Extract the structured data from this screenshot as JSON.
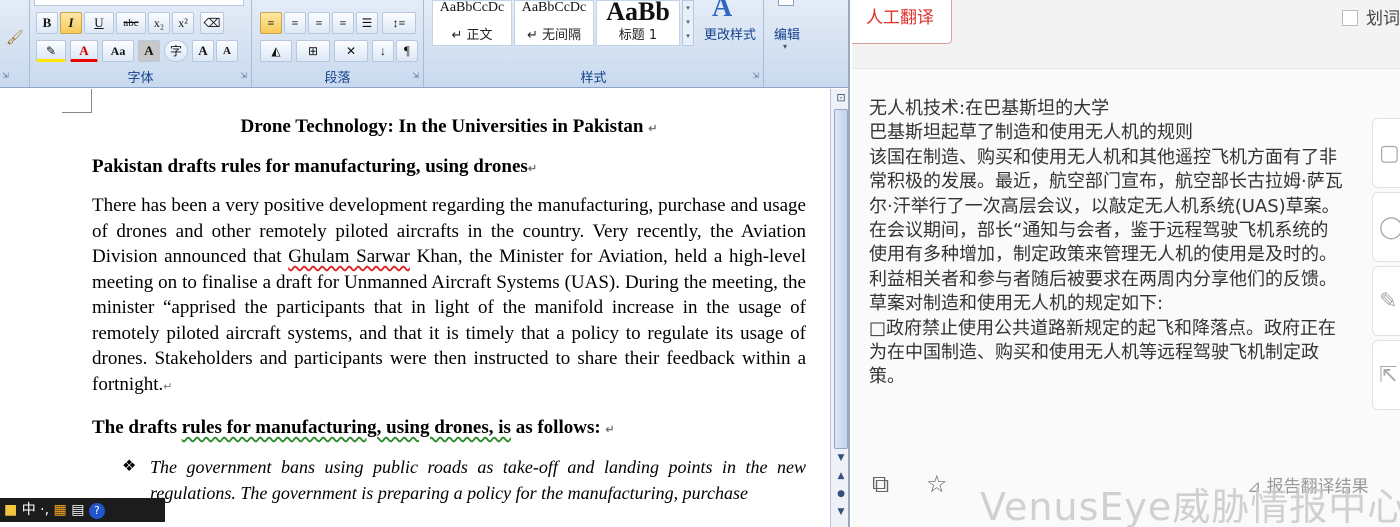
{
  "ribbon": {
    "font_group_label": "字体",
    "paragraph_group_label": "段落",
    "styles_group_label": "样式",
    "bold": "B",
    "italic": "I",
    "underline": "U",
    "strikethrough": "abc",
    "subscript": "x₂",
    "superscript": "x²",
    "change_case": "Aa",
    "font_color": "A",
    "char_shading": "A",
    "char_border": "字",
    "grow_font": "A",
    "shrink_font": "A",
    "styles": [
      {
        "sample": "AaBbCcDc",
        "name": "↵ 正文"
      },
      {
        "sample": "AaBbCcDc",
        "name": "↵ 无间隔"
      },
      {
        "sample": "AaBb",
        "name": "标题 1"
      }
    ],
    "change_styles_label": "更改样式",
    "edit_label": "编辑"
  },
  "document": {
    "title": "Drone Technology: In the Universities in Pakistan",
    "heading1": "Pakistan drafts rules for manufacturing, using drones",
    "para1_a": "There has been a very positive development regarding the manufacturing, purchase and usage of drones and other remotely piloted aircrafts in the country. Very recently, the Aviation Division announced that ",
    "para1_name": "Ghulam Sarwar",
    "para1_b": " Khan, the Minister for Aviation, held a high-level meeting on to finalise a draft for Unmanned Aircraft Systems (UAS). During the meeting, the minister “apprised the participants that in light of the manifold increase in the usage of remotely piloted aircraft systems, and that it is timely that a policy to regulate its usage of drones. Stakeholders and participants were then instructed to share their feedback within a fortnight.",
    "heading2_a": "The drafts ",
    "heading2_b": "rules for manufacturing, using drones, is",
    "heading2_c": " as follows:",
    "bullet1": "The government bans using public roads as take-off and landing points in the new regulations. The government is preparing a policy for the manufacturing, purchase"
  },
  "ime": {
    "text": "中 ·, "
  },
  "translator": {
    "human_translate": "人工翻译",
    "word_select": "划词",
    "lines": [
      "无人机技术:在巴基斯坦的大学",
      "巴基斯坦起草了制造和使用无人机的规则",
      "该国在制造、购买和使用无人机和其他遥控飞机方面有了非",
      "常积极的发展。最近，航空部门宣布，航空部长古拉姆·萨瓦",
      "尔·汗举行了一次高层会议，以敲定无人机系统(UAS)草案。",
      "在会议期间，部长“通知与会者，鉴于远程驾驶飞机系统的",
      "使用有多种增加，制定政策来管理无人机的使用是及时的。",
      "利益相关者和参与者随后被要求在两周内分享他们的反馈。",
      "草案对制造和使用无人机的规定如下:",
      "□政府禁止使用公共道路新规定的起飞和降落点。政府正在",
      "为在中国制造、购买和使用无人机等远程驾驶飞机制定政",
      "策。"
    ],
    "feedback": "⊿ 报告翻译结果",
    "watermark": "VenusEye威胁情报中心"
  }
}
